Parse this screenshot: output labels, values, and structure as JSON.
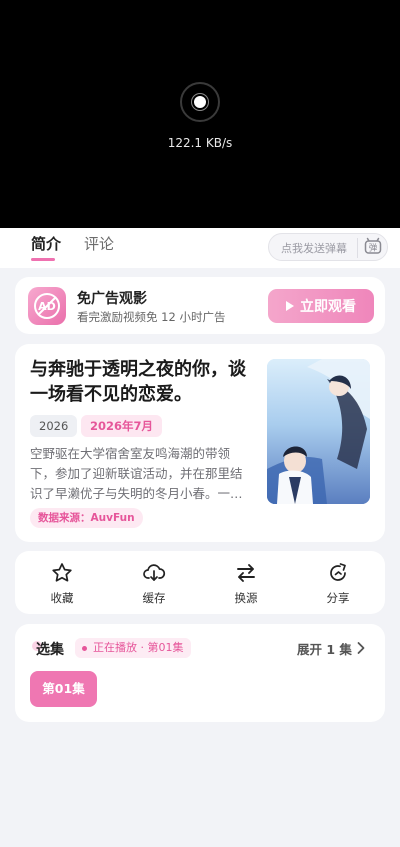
{
  "player": {
    "speed": "122.1 KB/s"
  },
  "tabs": [
    {
      "label": "简介"
    },
    {
      "label": "评论"
    }
  ],
  "danmaku": {
    "placeholder": "点我发送弹幕",
    "icon": "danmaku-icon",
    "badge": "弹"
  },
  "ad": {
    "logo_text": "AD",
    "title": "免广告观影",
    "subtitle": "看完激励视频免 12 小时广告",
    "button": "立即观看"
  },
  "anime": {
    "title": "与奔驰于透明之夜的你，谈一场看不见的恋爱。",
    "year": "2026",
    "date": "2026年7月",
    "description": "空野驱在大学宿舍室友鸣海潮的带领下，参加了迎新联谊活动，并在那里结识了早濑优子与失明的冬月小春。一…",
    "source": "数据来源：AuvFun"
  },
  "actions": [
    {
      "label": "收藏",
      "icon": "star-icon"
    },
    {
      "label": "缓存",
      "icon": "download-icon"
    },
    {
      "label": "换源",
      "icon": "switch-icon"
    },
    {
      "label": "分享",
      "icon": "share-icon"
    }
  ],
  "episodes": {
    "title": "选集",
    "status": "正在播放 · 第01集",
    "expand": "展开 1 集",
    "list": [
      {
        "label": "第01集"
      }
    ]
  },
  "colors": {
    "accent": "#ef77b2",
    "accent_light": "#fde7f1",
    "background": "#f2f3f7"
  }
}
